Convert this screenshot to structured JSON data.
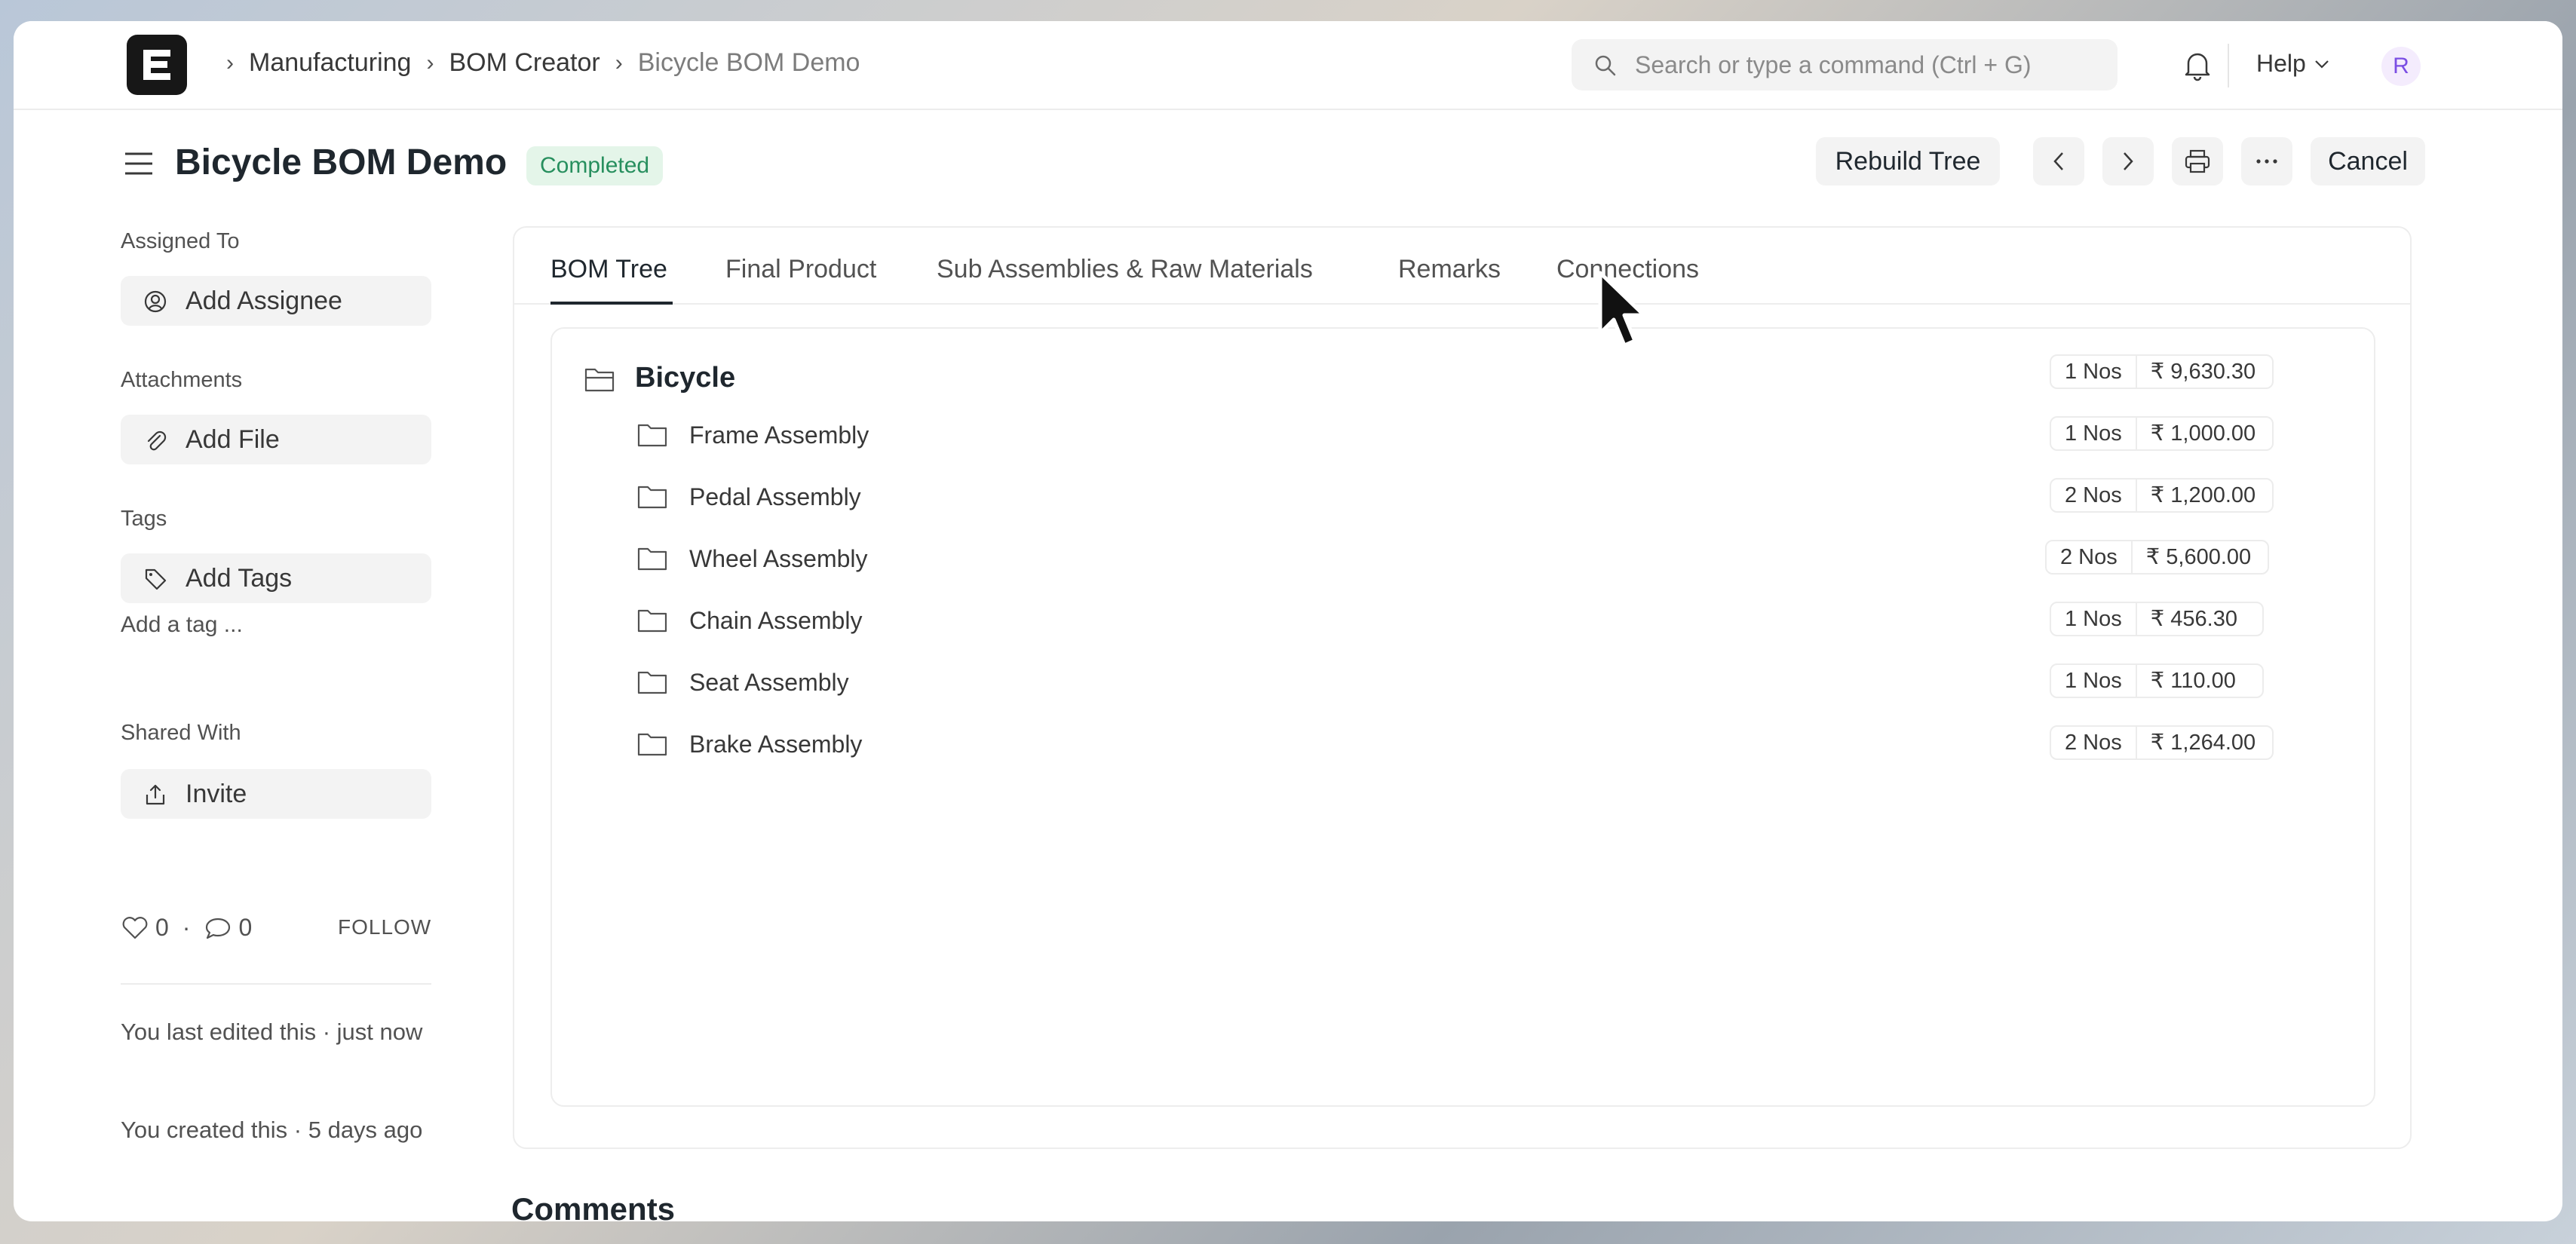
{
  "navbar": {
    "breadcrumbs": [
      "Manufacturing",
      "BOM Creator",
      "Bicycle BOM Demo"
    ],
    "search_placeholder": "Search or type a command (Ctrl + G)",
    "help_label": "Help",
    "avatar_initial": "R",
    "icons": [
      "app-logo-icon",
      "search-icon",
      "bell-icon",
      "chevron-down-icon"
    ]
  },
  "page": {
    "title": "Bicycle BOM Demo",
    "status": "Completed",
    "status_color": "#278f5e",
    "actions": {
      "rebuild_tree": "Rebuild Tree",
      "cancel": "Cancel"
    }
  },
  "sidebar": {
    "assigned_to_label": "Assigned To",
    "add_assignee": "Add Assignee",
    "attachments_label": "Attachments",
    "add_file": "Add File",
    "tags_label": "Tags",
    "add_tags": "Add Tags",
    "add_tag_hint": "Add a tag ...",
    "shared_with_label": "Shared With",
    "invite": "Invite",
    "likes": "0",
    "comments_count": "0",
    "follow": "FOLLOW",
    "last_edited": "You last edited this · just now",
    "created": "You created this · 5 days ago"
  },
  "tabs": [
    "BOM Tree",
    "Final Product",
    "Sub Assemblies & Raw Materials",
    "Remarks",
    "Connections"
  ],
  "active_tab": "BOM Tree",
  "tree": {
    "root": {
      "name": "Bicycle",
      "qty": "1 Nos",
      "amount": "₹ 9,630.30"
    },
    "children": [
      {
        "name": "Frame Assembly",
        "qty": "1 Nos",
        "amount": "₹ 1,000.00"
      },
      {
        "name": "Pedal Assembly",
        "qty": "2 Nos",
        "amount": "₹ 1,200.00"
      },
      {
        "name": "Wheel Assembly",
        "qty": "2 Nos",
        "amount": "₹ 5,600.00"
      },
      {
        "name": "Chain Assembly",
        "qty": "1 Nos",
        "amount": "₹ 456.30"
      },
      {
        "name": "Seat Assembly",
        "qty": "1 Nos",
        "amount": "₹ 110.00"
      },
      {
        "name": "Brake Assembly",
        "qty": "2 Nos",
        "amount": "₹ 1,264.00"
      }
    ]
  },
  "comments_heading": "Comments"
}
